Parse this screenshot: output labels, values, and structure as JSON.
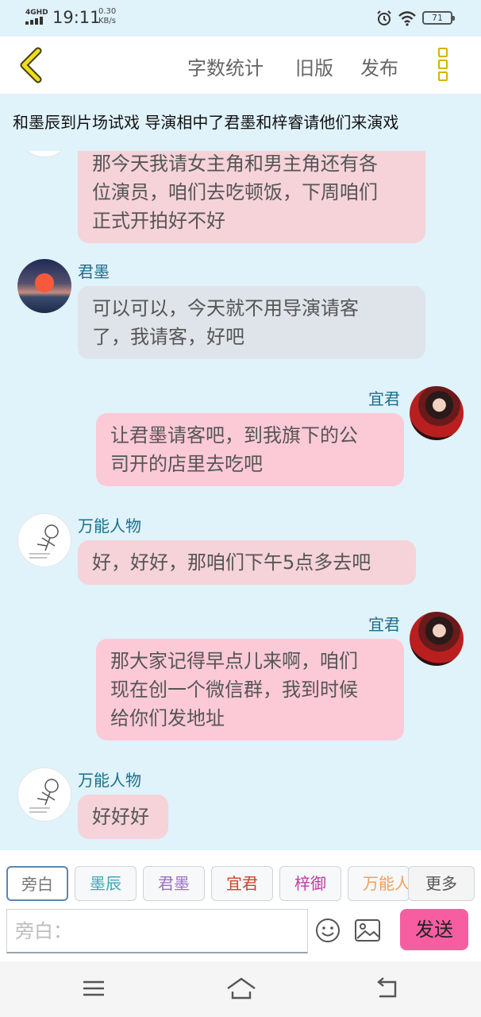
{
  "status_bar": {
    "network": "4GHD",
    "time": "19:11",
    "speed_value": "0.30",
    "speed_unit": "KB/s",
    "battery": "71"
  },
  "toolbar": {
    "word_count_label": "字数统计",
    "old_version_label": "旧版",
    "publish_label": "发布"
  },
  "scene": {
    "text": "和墨辰到片场试戏  导演相中了君墨和梓睿请他们来演戏"
  },
  "messages": [
    {
      "side": "left",
      "speaker": "",
      "lines": [
        "那今天我请女主角和男主角还有各",
        "位演员，咱们去吃顿饭，下周咱们",
        "正式开拍好不好"
      ]
    },
    {
      "side": "left",
      "speaker": "君墨",
      "lines": [
        "可以可以，今天就不用导演请客",
        "了，我请客，好吧"
      ]
    },
    {
      "side": "right",
      "speaker": "宜君",
      "lines": [
        "让君墨请客吧，到我旗下的公",
        "司开的店里去吃吧"
      ]
    },
    {
      "side": "left",
      "speaker": "万能人物",
      "lines": [
        "好，好好，那咱们下午5点多去吧"
      ]
    },
    {
      "side": "right",
      "speaker": "宜君",
      "lines": [
        "那大家记得早点儿来啊，咱们",
        "现在创一个微信群，我到时候",
        "给你们发地址"
      ]
    },
    {
      "side": "left",
      "speaker": "万能人物",
      "lines": [
        "好好好"
      ]
    }
  ],
  "roles": [
    {
      "label": "旁白",
      "color": "#777777"
    },
    {
      "label": "墨辰",
      "color": "#3fa7b5"
    },
    {
      "label": "君墨",
      "color": "#9b6fc7"
    },
    {
      "label": "宜君",
      "color": "#d0432b"
    },
    {
      "label": "梓御",
      "color": "#c23aa6"
    },
    {
      "label": "万能人",
      "color": "#f0a05a"
    }
  ],
  "more_label": "更多",
  "input": {
    "placeholder": "旁白："
  },
  "send_label": "发送",
  "colors": {
    "background": "#e0f2fa",
    "accent_yellow": "#d4b300",
    "send_pink": "#f65ea1",
    "bubble_pink": "#fccad6",
    "bubble_gray": "#dfe4ea"
  }
}
